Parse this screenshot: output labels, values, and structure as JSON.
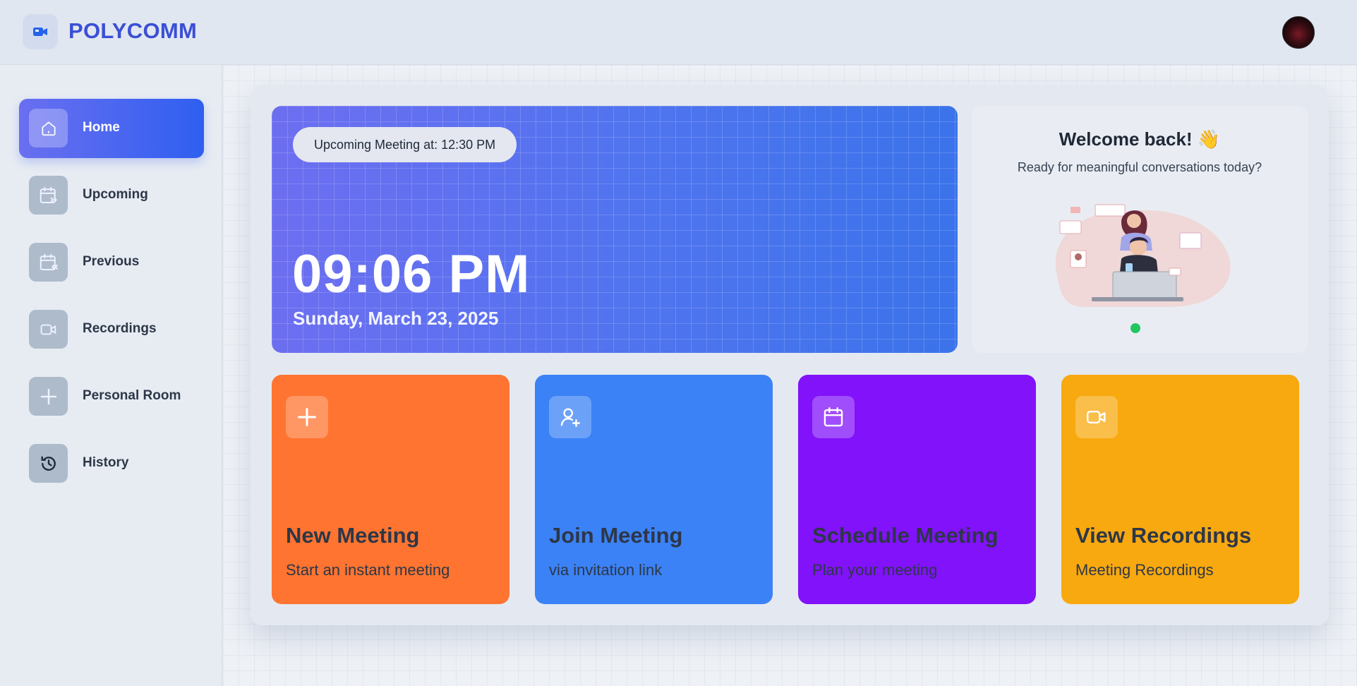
{
  "app": {
    "brand": "POLYCOMM",
    "brand_color": "#3b4fd6",
    "logo_icon": "video-camera-icon"
  },
  "header": {
    "avatar_icon": "user-avatar"
  },
  "sidebar": {
    "items": [
      {
        "label": "Home",
        "icon": "home-icon",
        "active": true
      },
      {
        "label": "Upcoming",
        "icon": "calendar-forward-icon",
        "active": false
      },
      {
        "label": "Previous",
        "icon": "calendar-back-icon",
        "active": false
      },
      {
        "label": "Recordings",
        "icon": "video-icon",
        "active": false
      },
      {
        "label": "Personal Room",
        "icon": "plus-icon",
        "active": false
      },
      {
        "label": "History",
        "icon": "history-icon",
        "active": false
      }
    ]
  },
  "hero": {
    "upcoming_label": "Upcoming Meeting at: 12:30 PM",
    "time": "09:06 PM",
    "date": "Sunday, March 23, 2025"
  },
  "welcome": {
    "title": "Welcome back! 👋",
    "subtitle": "Ready for meaningful conversations today?",
    "status_color": "#22c55e"
  },
  "cards": [
    {
      "title": "New Meeting",
      "subtitle": "Start an instant meeting",
      "icon": "plus-icon",
      "color": "#ff7430"
    },
    {
      "title": "Join Meeting",
      "subtitle": "via invitation link",
      "icon": "user-plus-icon",
      "color": "#3b82f6"
    },
    {
      "title": "Schedule Meeting",
      "subtitle": "Plan your meeting",
      "icon": "calendar-icon",
      "color": "#8112fa"
    },
    {
      "title": "View Recordings",
      "subtitle": "Meeting Recordings",
      "icon": "video-icon",
      "color": "#f8a90f"
    }
  ]
}
